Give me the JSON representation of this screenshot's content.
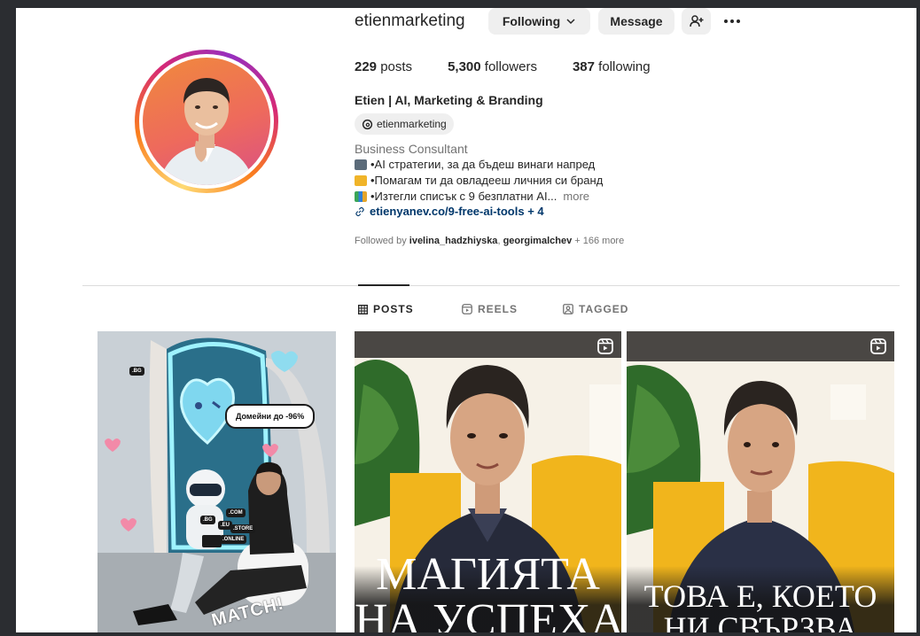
{
  "profile": {
    "username": "etienmarketing",
    "buttons": {
      "following": "Following",
      "message": "Message"
    },
    "stats": {
      "posts_count": "229",
      "posts_label": "posts",
      "followers_count": "5,300",
      "followers_label": "followers",
      "following_count": "387",
      "following_label": "following"
    },
    "full_name": "Etien | AI, Marketing & Branding",
    "threads_handle": "etienmarketing",
    "category": "Business Consultant",
    "bio": {
      "line1": "•AI стратегии, за да бъдеш винаги напред",
      "line2": "•Помагам ти да овладееш личния си бранд",
      "line3": "•Изтегли списък с 9 безплатни AI...",
      "more": "more"
    },
    "link": "etienyanev.co/9-free-ai-tools + 4",
    "followed_by": {
      "prefix": "Followed by",
      "user1": "ivelina_hadzhiyska",
      "separator": ",",
      "user2": "georgimalchev",
      "suffix": "+ 166 more"
    }
  },
  "tabs": [
    {
      "label": "POSTS",
      "icon": "grid-icon",
      "active": true
    },
    {
      "label": "REELS",
      "icon": "reels-icon",
      "active": false
    },
    {
      "label": "TAGGED",
      "icon": "tagged-icon",
      "active": false
    }
  ],
  "posts": [
    {
      "type": "image",
      "chips": [
        ".BG",
        ".COM",
        ".BG",
        ".EU",
        ".STORE",
        ".ONLINE"
      ],
      "bubble": "Домейни до -96%",
      "overlay_text": "MATCH!"
    },
    {
      "type": "reel",
      "caption_line1": "МАГИЯТА",
      "caption_line2": "НА УСПЕХА"
    },
    {
      "type": "reel",
      "caption_line1": "ТОВА Е, КОЕТО",
      "caption_line2": "НИ СВЪРЗВА"
    }
  ],
  "colors": {
    "link": "#00376b",
    "secondary_text": "#737373",
    "button_bg": "#efefef",
    "divider": "#dbdbdb"
  }
}
